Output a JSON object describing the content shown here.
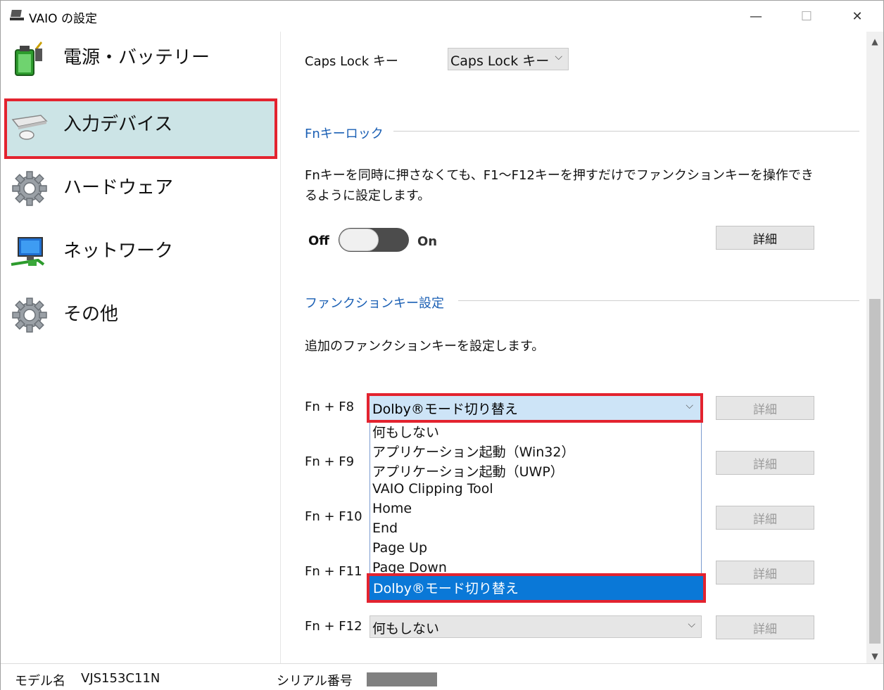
{
  "window": {
    "title": "VAIO の設定",
    "minimize_glyph": "—",
    "maximize_glyph": "☐",
    "close_glyph": "✕"
  },
  "sidebar": {
    "items": [
      {
        "label": "電源・バッテリー",
        "icon": "battery-icon"
      },
      {
        "label": "入力デバイス",
        "icon": "keyboard-mouse-icon",
        "selected": true
      },
      {
        "label": "ハードウェア",
        "icon": "gear-icon"
      },
      {
        "label": "ネットワーク",
        "icon": "network-computer-icon"
      },
      {
        "label": "その他",
        "icon": "gear-icon"
      }
    ]
  },
  "content": {
    "capslock": {
      "label": "Caps Lock キー",
      "value": "Caps Lock キー"
    },
    "fn_lock": {
      "title": "Fnキーロック",
      "description_line1": "Fnキーを同時に押さなくても、F1〜F12キーを押すだけでファンクションキーを操作でき",
      "description_line2": "るように設定します。",
      "toggle_off": "Off",
      "toggle_on": "On",
      "toggle_state": "off",
      "details_button": "詳細"
    },
    "function_keys": {
      "title": "ファンクションキー設定",
      "description": "追加のファンクションキーを設定します。",
      "rows": [
        {
          "key": "Fn + F8",
          "value": "Dolby®モード切り替え",
          "details": "詳細"
        },
        {
          "key": "Fn + F9",
          "value": "",
          "details": "詳細"
        },
        {
          "key": "Fn + F10",
          "value": "",
          "details": "詳細"
        },
        {
          "key": "Fn + F11",
          "value": "",
          "details": "詳細"
        },
        {
          "key": "Fn + F12",
          "value": "何もしない",
          "details": "詳細"
        }
      ],
      "dropdown_options": [
        "何もしない",
        "アプリケーション起動（Win32）",
        "アプリケーション起動（UWP）",
        "VAIO Clipping Tool",
        "Home",
        "End",
        "Page Up",
        "Page Down",
        "Dolby®モード切り替え"
      ],
      "dropdown_selected": "Dolby®モード切り替え"
    }
  },
  "status": {
    "model_label": "モデル名",
    "model_value": "VJS153C11N",
    "serial_label": "シリアル番号"
  },
  "colors": {
    "highlight_red": "#e3232f",
    "section_blue": "#1a5fb4",
    "selected_nav_bg": "#cce4e6",
    "dropdown_selected_bg": "#0a78d7"
  }
}
